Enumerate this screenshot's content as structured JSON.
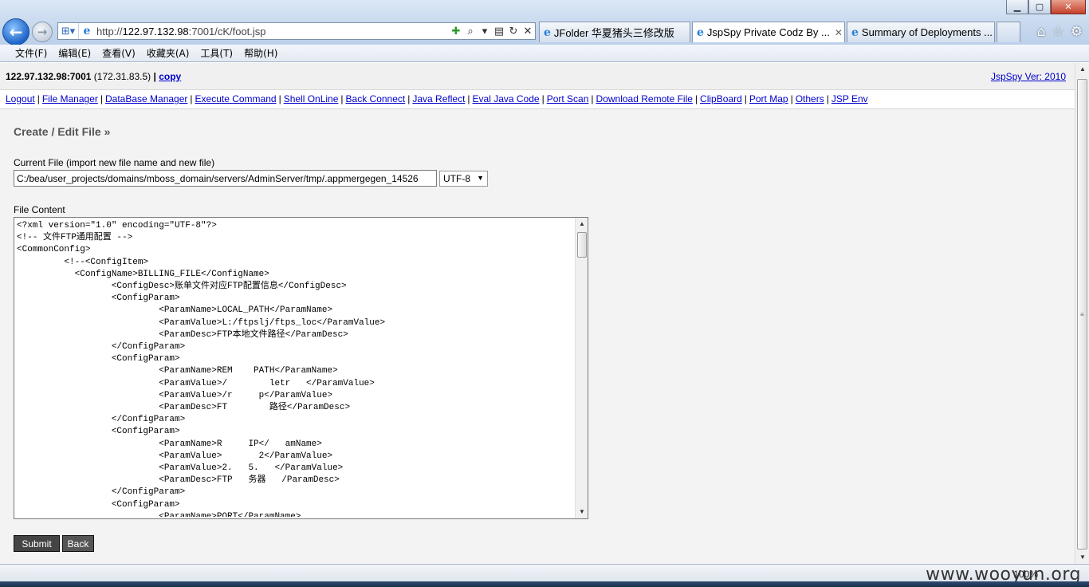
{
  "browser": {
    "address": {
      "prefix": "http://",
      "host": "122.97.132.98",
      "path": ":7001/cK/foot.jsp"
    },
    "tabs": [
      {
        "label": "JFolder 华夏猪头三修改版",
        "active": false
      },
      {
        "label": "JspSpy Private Codz By ...",
        "active": true
      },
      {
        "label": "Summary of Deployments ...",
        "active": false
      }
    ],
    "menu": [
      "文件(F)",
      "编辑(E)",
      "查看(V)",
      "收藏夹(A)",
      "工具(T)",
      "帮助(H)"
    ],
    "caption": {
      "minimize": "▁",
      "maximize": "▢",
      "close": "✕"
    },
    "icons": {
      "back": "back-arrow-icon",
      "forward": "forward-arrow-icon",
      "home": "home-icon",
      "favorites": "star-icon",
      "tools": "gear-icon"
    },
    "zoom": "100%"
  },
  "header": {
    "server": "122.97.132.98:7001",
    "server_ip": "(172.31.83.5)",
    "separator": "|",
    "copy_label": "copy",
    "version": "JspSpy Ver: 2010"
  },
  "nav": [
    "Logout",
    "File Manager",
    "DataBase Manager",
    "Execute Command",
    "Shell OnLine",
    "Back Connect",
    "Java Reflect",
    "Eval Java Code",
    "Port Scan",
    "Download Remote File",
    "ClipBoard",
    "Port Map",
    "Others",
    "JSP Env"
  ],
  "form": {
    "title": "Create / Edit File »",
    "current_file_label": "Current File (import new file name and new file)",
    "current_file_value": "C:/bea/user_projects/domains/mboss_domain/servers/AdminServer/tmp/.appmergegen_14526",
    "encoding": "UTF-8",
    "file_content_label": "File Content",
    "file_content": "<?xml version=\"1.0\" encoding=\"UTF-8\"?>\n<!-- 文件FTP通用配置 -->\n<CommonConfig>\n         <!--<ConfigItem>\n           <ConfigName>BILLING_FILE</ConfigName>\n                  <ConfigDesc>账单文件对应FTP配置信息</ConfigDesc>\n                  <ConfigParam>\n                           <ParamName>LOCAL_PATH</ParamName>\n                           <ParamValue>L:/ftpslj/ftps_loc</ParamValue>\n                           <ParamDesc>FTP本地文件路径</ParamDesc>\n                  </ConfigParam>\n                  <ConfigParam>\n                           <ParamName>REM    PATH</ParamName>\n                           <ParamValue>/        letr   </ParamValue>\n                           <ParamValue>/r     p</ParamValue>\n                           <ParamDesc>FT        路径</ParamDesc>\n                  </ConfigParam>\n                  <ConfigParam>\n                           <ParamName>R     IP</   amName>\n                           <ParamValue>       2</ParamValue>\n                           <ParamValue>2.   5.   </ParamValue>\n                           <ParamDesc>FTP   务器   /ParamDesc>\n                  </ConfigParam>\n                  <ConfigParam>\n                           <ParamName>PORT</ParamName>",
    "submit_label": "Submit",
    "back_label": "Back"
  },
  "watermark": "www.wooyun.org"
}
